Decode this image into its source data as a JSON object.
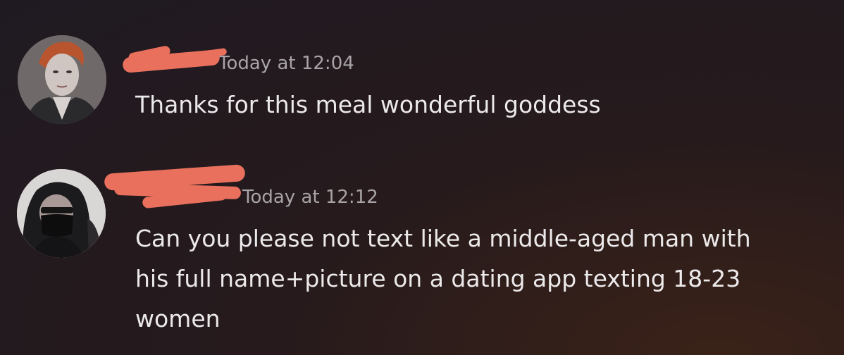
{
  "messages": [
    {
      "author": "",
      "timestamp": "Today at 12:04",
      "lines": [
        "Thanks for this meal wonderful goddess"
      ]
    },
    {
      "author": "",
      "timestamp": "Today at 12:12",
      "lines": [
        "Can you please not text like a middle-aged man with",
        "his full name+picture on a dating app texting 18-23",
        "women"
      ]
    }
  ],
  "colors": {
    "redaction": "#e8705d",
    "timestamp": "#a7a3a6",
    "text": "#ece9ea"
  }
}
